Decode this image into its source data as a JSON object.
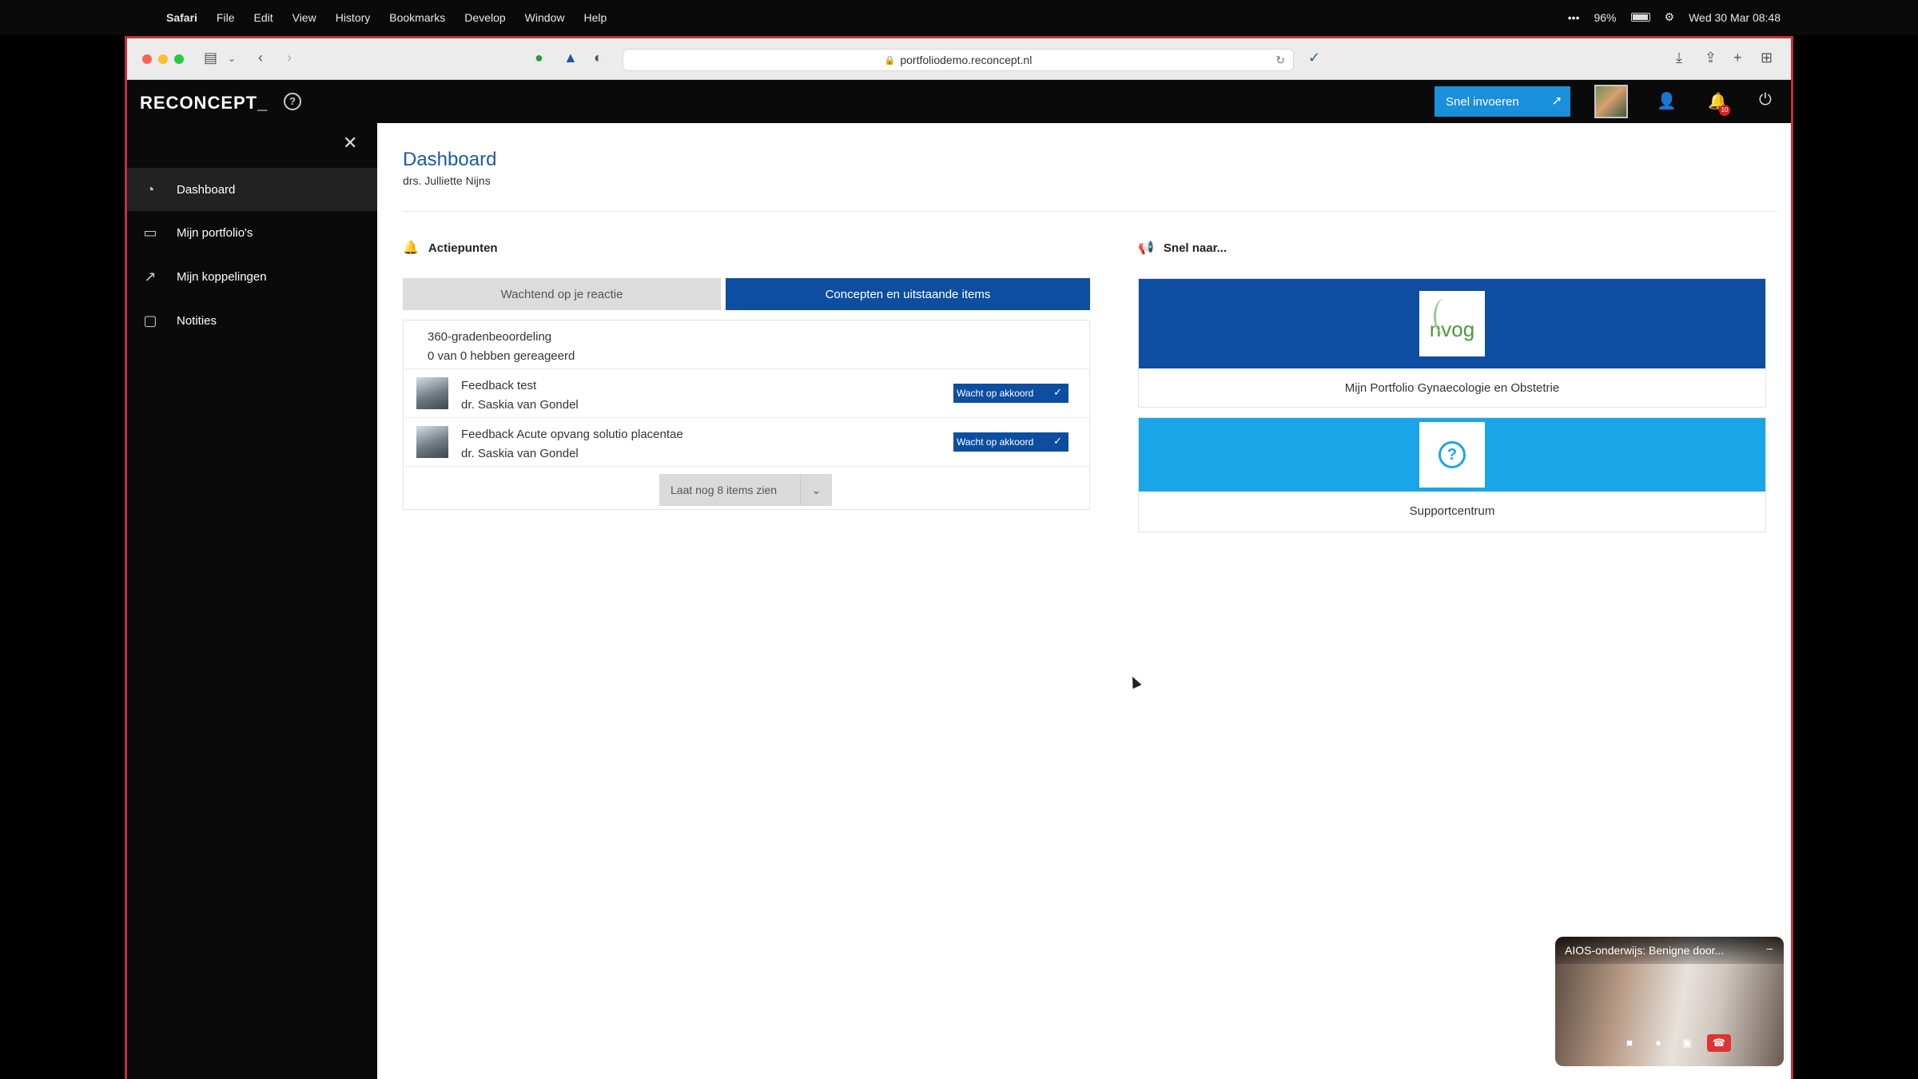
{
  "menubar": {
    "app": "Safari",
    "menus": [
      "File",
      "Edit",
      "View",
      "History",
      "Bookmarks",
      "Develop",
      "Window",
      "Help"
    ],
    "battery": "96%",
    "datetime": "Wed 30 Mar 08:48"
  },
  "browser": {
    "url": "portfoliodemo.reconcept.nl"
  },
  "appbar": {
    "logo": "RECONCEPT_",
    "quick_entry": "Snel invoeren",
    "notification_count": "10"
  },
  "sidebar": {
    "items": [
      {
        "label": "Dashboard",
        "icon": "dashboard-icon"
      },
      {
        "label": "Mijn portfolio's",
        "icon": "portfolio-icon"
      },
      {
        "label": "Mijn koppelingen",
        "icon": "external-link-icon"
      },
      {
        "label": "Notities",
        "icon": "note-icon"
      }
    ]
  },
  "page": {
    "title": "Dashboard",
    "subtitle": "drs. Julliette Nijns"
  },
  "actions": {
    "heading": "Actiepunten",
    "tabs": [
      {
        "label": "Wachtend op je reactie"
      },
      {
        "label": "Concepten en uitstaande items"
      }
    ],
    "rows": [
      {
        "title": "360-gradenbeoordeling",
        "sub": "0 van 0 hebben gereageerd"
      },
      {
        "title": "Feedback test",
        "sub": "dr. Saskia van Gondel",
        "status": "Wacht op akkoord"
      },
      {
        "title": "Feedback Acute opvang solutio placentae",
        "sub": "dr. Saskia van Gondel",
        "status": "Wacht op akkoord"
      }
    ],
    "more": "Laat nog 8 items zien"
  },
  "quick": {
    "heading": "Snel naar...",
    "cards": [
      {
        "label": "Mijn Portfolio Gynaecologie en Obstetrie",
        "logo_text": "nvog",
        "color": "#0d4ea0"
      },
      {
        "label": "Supportcentrum",
        "color": "#1aa5e8"
      }
    ]
  },
  "pip": {
    "title": "AIOS-onderwijs: Benigne door..."
  }
}
